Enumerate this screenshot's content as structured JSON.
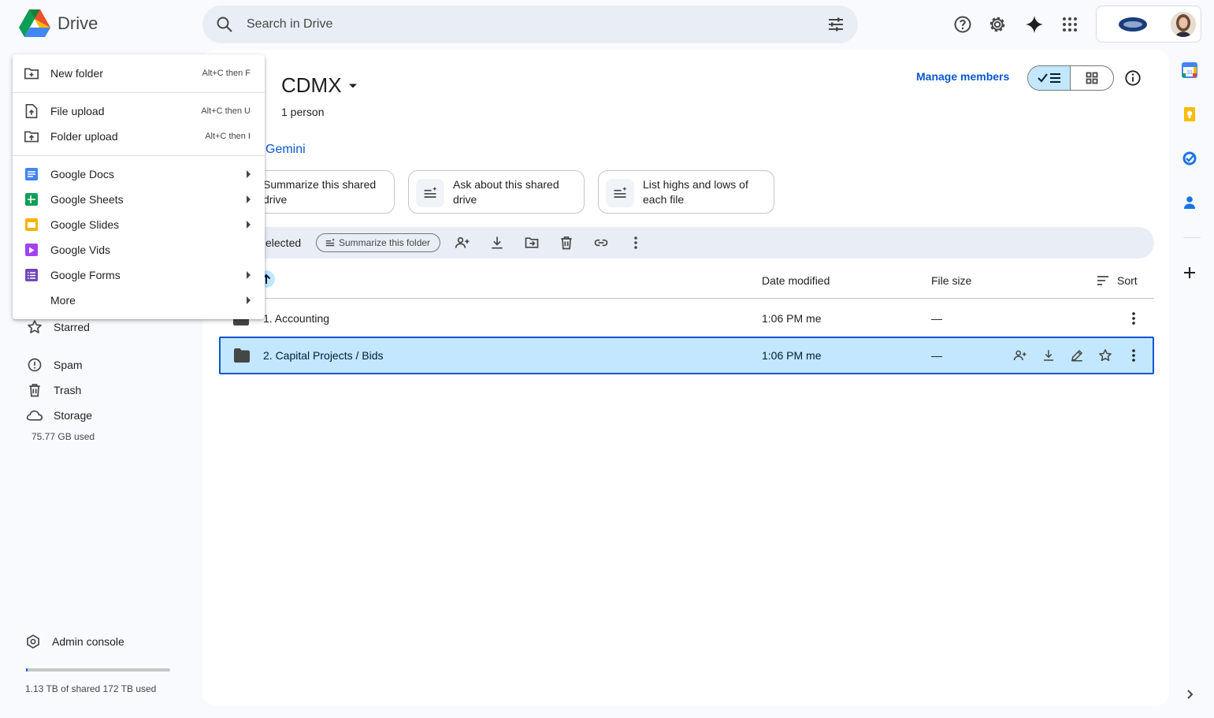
{
  "app": {
    "name": "Drive"
  },
  "search": {
    "placeholder": "Search in Drive"
  },
  "header_icons": [
    "help-icon",
    "settings-icon",
    "gemini-icon",
    "apps-grid-icon"
  ],
  "new_menu": {
    "items": [
      {
        "label": "New folder",
        "shortcut": "Alt+C then F",
        "icon": "new-folder-icon"
      },
      {
        "label": "File upload",
        "shortcut": "Alt+C then U",
        "icon": "file-upload-icon"
      },
      {
        "label": "Folder upload",
        "shortcut": "Alt+C then I",
        "icon": "folder-upload-icon"
      },
      {
        "label": "Google Docs",
        "icon": "docs-icon",
        "color": "#4285f4"
      },
      {
        "label": "Google Sheets",
        "icon": "sheets-icon",
        "color": "#0f9d58"
      },
      {
        "label": "Google Slides",
        "icon": "slides-icon",
        "color": "#f4b400"
      },
      {
        "label": "Google Vids",
        "icon": "vids-icon",
        "color": "#a142f4"
      },
      {
        "label": "Google Forms",
        "icon": "forms-icon",
        "color": "#7248b9"
      },
      {
        "label": "More",
        "icon": "more-icon"
      }
    ]
  },
  "left_nav": {
    "items": [
      {
        "label": "Starred",
        "icon": "star-icon"
      },
      {
        "label": "Spam",
        "icon": "spam-icon"
      },
      {
        "label": "Trash",
        "icon": "trash-icon"
      },
      {
        "label": "Storage",
        "icon": "cloud-icon"
      }
    ],
    "storage_used": "75.77 GB used",
    "admin_console": "Admin console",
    "shared_storage": "1.13 TB of shared 172 TB used",
    "shared_storage_fraction": 0.0066
  },
  "drive": {
    "title": "CDMX",
    "members": "1 person",
    "manage_members": "Manage members"
  },
  "gemini": {
    "heading": "Gemini",
    "suggestions": [
      "Summarize this shared drive",
      "Ask about this shared drive",
      "List highs and lows of each file"
    ]
  },
  "selection_bar": {
    "count": "elected",
    "summarize_folder": "Summarize this folder"
  },
  "file_list": {
    "columns": {
      "date": "Date modified",
      "size": "File size",
      "sort": "Sort"
    },
    "rows": [
      {
        "name": "1. Accounting",
        "date": "1:06 PM me",
        "size": "—"
      },
      {
        "name": "2. Capital Projects / Bids",
        "date": "1:06 PM me",
        "size": "—"
      }
    ]
  },
  "colors": {
    "accent": "#0b57d0",
    "selected": "#c2e7ff",
    "surface": "#f8fafd"
  }
}
